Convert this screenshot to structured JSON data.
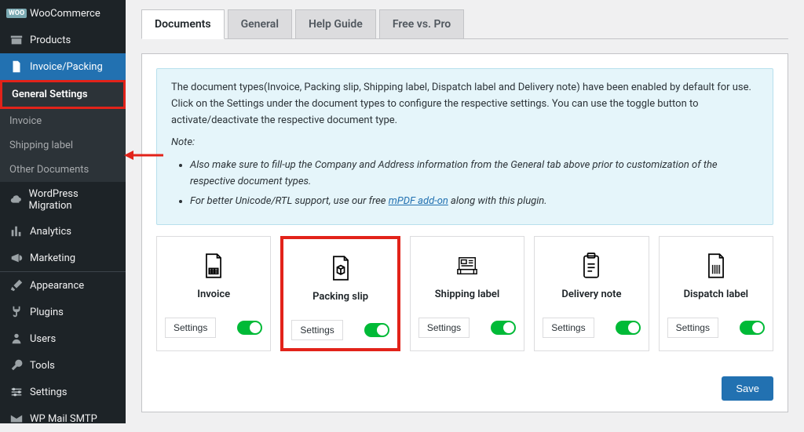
{
  "sidebar": {
    "items": [
      {
        "label": "WooCommerce",
        "icon": "woo"
      },
      {
        "label": "Products",
        "icon": "archive"
      },
      {
        "label": "Invoice/Packing",
        "icon": "document",
        "active": true
      },
      {
        "label": "WordPress Migration",
        "icon": "cloud"
      },
      {
        "label": "Analytics",
        "icon": "chart"
      },
      {
        "label": "Marketing",
        "icon": "megaphone"
      },
      {
        "label": "Appearance",
        "icon": "brush"
      },
      {
        "label": "Plugins",
        "icon": "plug"
      },
      {
        "label": "Users",
        "icon": "user"
      },
      {
        "label": "Tools",
        "icon": "wrench"
      },
      {
        "label": "Settings",
        "icon": "sliders"
      },
      {
        "label": "WP Mail SMTP",
        "icon": "mail"
      }
    ],
    "subitems": [
      {
        "label": "General Settings",
        "highlight": true
      },
      {
        "label": "Invoice"
      },
      {
        "label": "Shipping label"
      },
      {
        "label": "Other Documents"
      }
    ]
  },
  "tabs": [
    {
      "label": "Documents",
      "active": true
    },
    {
      "label": "General"
    },
    {
      "label": "Help Guide"
    },
    {
      "label": "Free vs. Pro"
    }
  ],
  "notice": {
    "intro": "The document types(Invoice, Packing slip, Shipping label, Dispatch label and Delivery note) have been enabled by default for use. Click on the Settings under the document types to configure the respective settings. You can use the toggle button to activate/deactivate the respective document type.",
    "note_label": "Note:",
    "bullets": [
      "Also make sure to fill-up the Company and Address information from the General tab above prior to customization of the respective document types.",
      "For better Unicode/RTL support, use our free "
    ],
    "link_text": "mPDF add-on",
    "bullet_suffix": " along with this plugin."
  },
  "cards": [
    {
      "title": "Invoice",
      "settings": "Settings",
      "icon": "invoice"
    },
    {
      "title": "Packing slip",
      "settings": "Settings",
      "icon": "packing",
      "highlight": true
    },
    {
      "title": "Shipping label",
      "settings": "Settings",
      "icon": "shipping"
    },
    {
      "title": "Delivery note",
      "settings": "Settings",
      "icon": "delivery"
    },
    {
      "title": "Dispatch label",
      "settings": "Settings",
      "icon": "dispatch"
    }
  ],
  "save_button": "Save"
}
